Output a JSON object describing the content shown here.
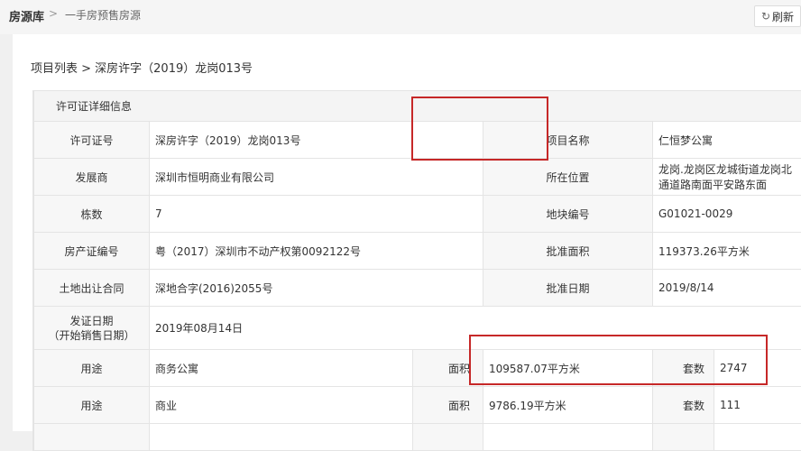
{
  "topbar": {
    "root": "房源库",
    "separator": ">",
    "current": "一手房预售房源",
    "refresh_label": "刷新"
  },
  "subcrumb": "项目列表 > 深房许字（2019）龙岗013号",
  "detail": {
    "header": "许可证详细信息",
    "rows": [
      {
        "l1": "许可证号",
        "v1": "深房许字（2019）龙岗013号",
        "l2": "项目名称",
        "v2": "仁恒梦公寓"
      },
      {
        "l1": "发展商",
        "v1": "深圳市恒明商业有限公司",
        "l2": "所在位置",
        "v2": "龙岗.龙岗区龙城街道龙岗北通道路南面平安路东面"
      },
      {
        "l1": "栋数",
        "v1": "7",
        "l2": "地块编号",
        "v2": "G01021-0029"
      },
      {
        "l1": "房产证编号",
        "v1": "粤（2017）深圳市不动产权第0092122号",
        "l2": "批准面积",
        "v2": "119373.26平方米"
      },
      {
        "l1": "土地出让合同",
        "v1": "深地合字(2016)2055号",
        "l2": "批准日期",
        "v2": "2019/8/14"
      }
    ],
    "issue_label_line1": "发证日期",
    "issue_label_line2": "（开始销售日期）",
    "issue_value": "2019年08月14日",
    "usage_rows": [
      {
        "usage_label": "用途",
        "usage": "商务公寓",
        "area_label": "面积",
        "area": "109587.07平方米",
        "units_label": "套数",
        "units": "2747"
      },
      {
        "usage_label": "用途",
        "usage": "商业",
        "area_label": "面积",
        "area": "9786.19平方米",
        "units_label": "套数",
        "units": "111"
      }
    ]
  }
}
